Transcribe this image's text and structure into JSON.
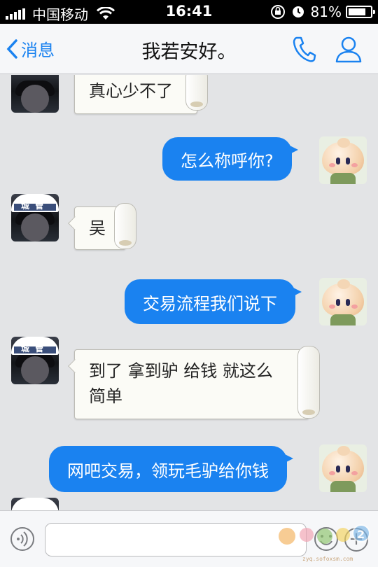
{
  "status_bar": {
    "carrier": "中国移动",
    "time": "16:41",
    "battery": "81%",
    "battery_level": 0.81
  },
  "nav": {
    "back_label": "消息",
    "title": "我若安好。",
    "accent_color": "#1a82f0"
  },
  "messages": [
    {
      "side": "left",
      "style": "scroll",
      "text": "真心少不了"
    },
    {
      "side": "right",
      "style": "bubble",
      "text": "怎么称呼你?"
    },
    {
      "side": "left",
      "style": "scroll",
      "text": "吴",
      "avatar_badge": "城管"
    },
    {
      "side": "right",
      "style": "bubble",
      "text": "交易流程我们说下"
    },
    {
      "side": "left",
      "style": "scroll",
      "text_line1": "到了 拿到驴 给钱  就这么",
      "text_line2": "简单",
      "avatar_badge": "城管"
    },
    {
      "side": "right",
      "style": "bubble",
      "text": "网吧交易，领玩毛驴给你钱"
    }
  ],
  "input": {
    "value": "",
    "placeholder": ""
  },
  "watermark": {
    "url_text": "zyq.sofoxsm.com"
  },
  "icons": [
    "signal-icon",
    "wifi-icon",
    "rotation-lock-icon",
    "alarm-icon",
    "battery-icon",
    "back-chevron-icon",
    "phone-icon",
    "contact-icon",
    "voice-icon",
    "emoji-icon",
    "plus-icon"
  ]
}
